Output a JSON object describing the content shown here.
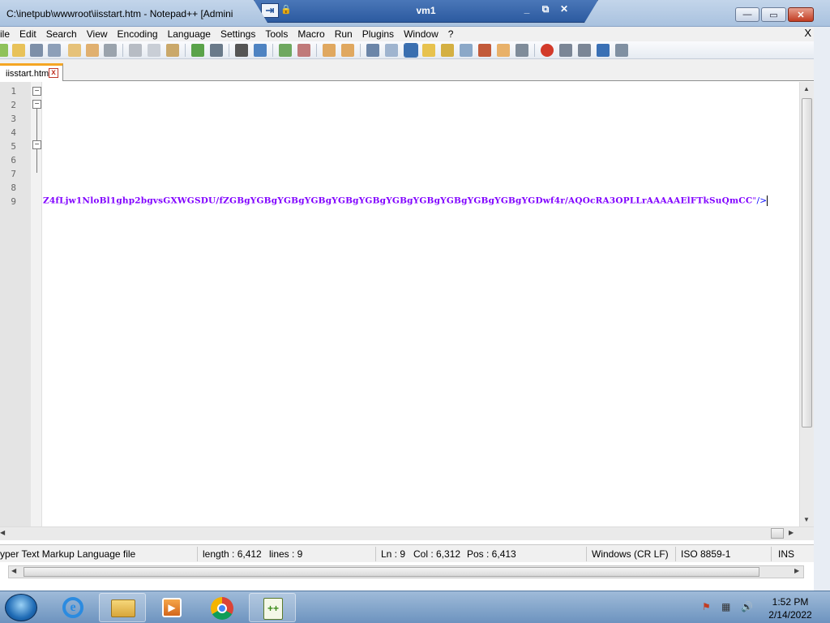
{
  "window": {
    "title": "C:\\inetpub\\wwwroot\\iisstart.htm - Notepad++ [Admini",
    "controls": {
      "minimize": "—",
      "maximize": "▭",
      "close": "✕"
    }
  },
  "rdp_bar": {
    "title": "vm1",
    "minimize": "_",
    "restore": "⧉",
    "close": "✕"
  },
  "menu": {
    "items": [
      "ile",
      "Edit",
      "Search",
      "View",
      "Encoding",
      "Language",
      "Settings",
      "Tools",
      "Macro",
      "Run",
      "Plugins",
      "Window",
      "?"
    ],
    "close_x": "X"
  },
  "tab": {
    "label": "iisstart.htm",
    "close": "x"
  },
  "editor": {
    "line_numbers": [
      "1",
      "2",
      "3",
      "4",
      "5",
      "6",
      "7",
      "8",
      "9"
    ],
    "line9_text": "Z4fLjw1NloBl1ghp2bgvsGXWGSDU/fZGBgYGBgYGBgYGBgYGBgYGBgYGBgYGBgYGBgYGBgYGBgYGDwf4r/AQOcRA3OPLLrAAAAAElFTkSuQmCC",
    "line9_quote": "\"",
    "line9_tag_end": "/>"
  },
  "status": {
    "file_type": "yper Text Markup Language file",
    "length": "length : 6,412",
    "lines": "lines : 9",
    "ln": "Ln : 9",
    "col": "Col : 6,312",
    "pos": "Pos : 6,413",
    "eol": "Windows (CR LF)",
    "encoding": "ISO 8859-1",
    "mode": "INS"
  },
  "taskbar": {
    "apps": [
      "internet-explorer",
      "file-explorer",
      "media-player",
      "chrome",
      "notepad-plus-plus"
    ],
    "time": "1:52 PM",
    "date": "2/14/2022"
  },
  "colors": {
    "code_text": "#8000ff",
    "tab_accent": "#f5a623",
    "taskbar": "#7b9fc8"
  }
}
